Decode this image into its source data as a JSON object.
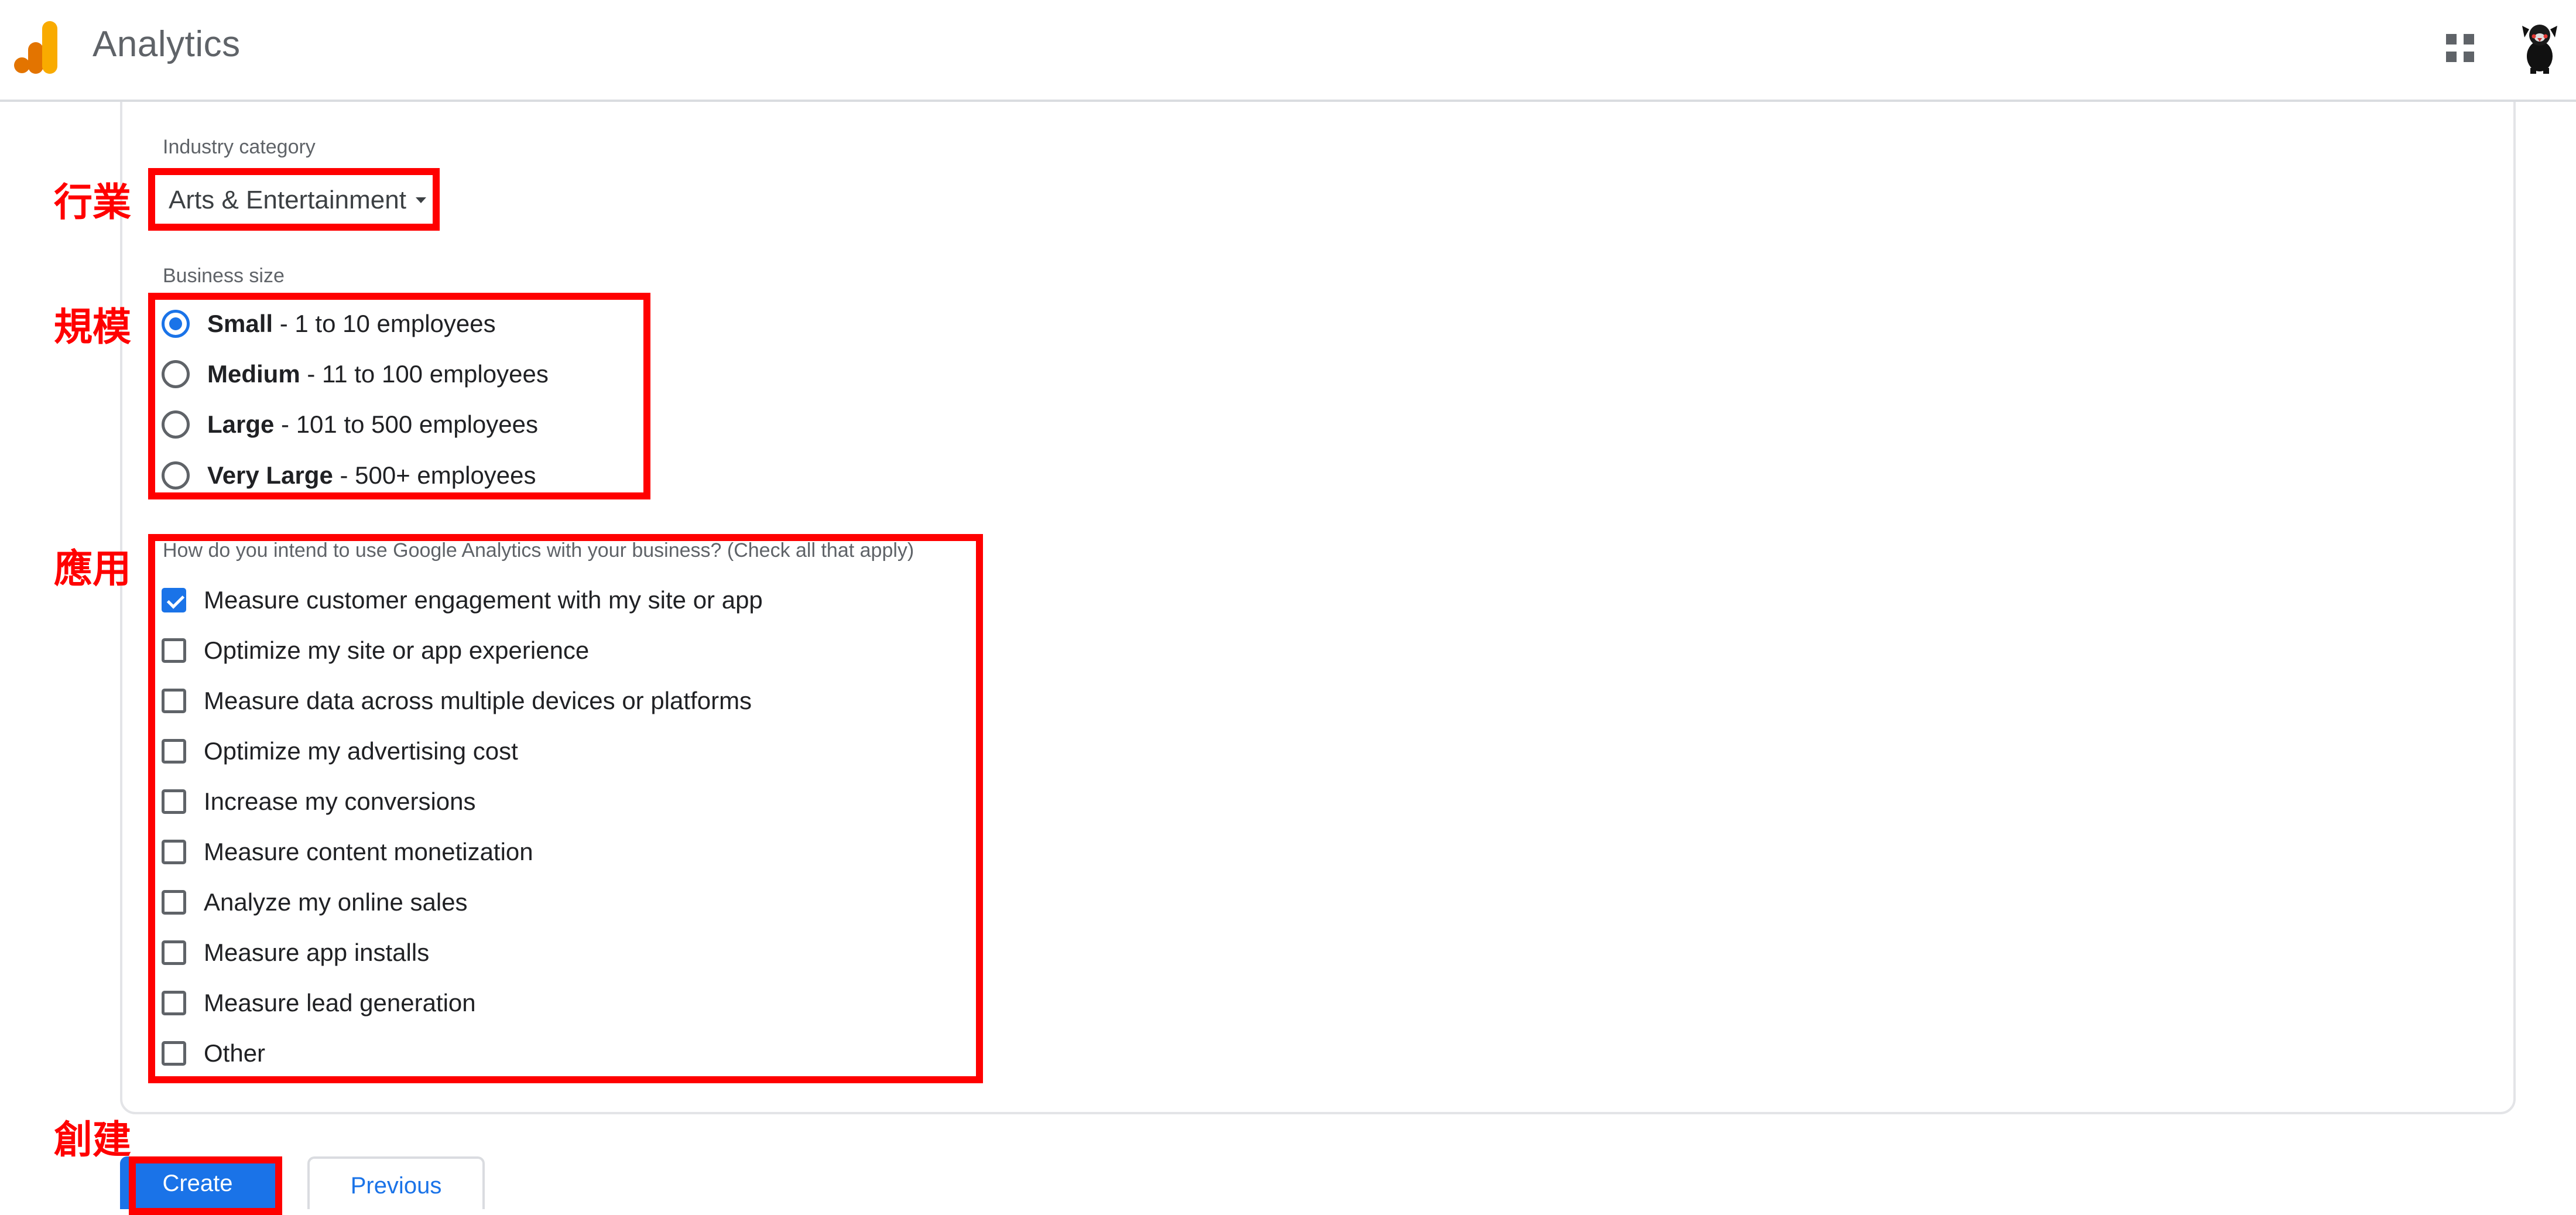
{
  "header": {
    "app_title": "Analytics",
    "icons": {
      "logo": "analytics-logo",
      "apps": "apps-grid-icon",
      "avatar": "user-avatar"
    }
  },
  "form": {
    "cutoff_text": "",
    "industry": {
      "label": "Industry category",
      "selected": "Arts & Entertainment"
    },
    "business_size": {
      "label": "Business size",
      "options": [
        {
          "name": "Small",
          "detail": " - 1 to 10 employees",
          "checked": true
        },
        {
          "name": "Medium",
          "detail": " - 11 to 100 employees",
          "checked": false
        },
        {
          "name": "Large",
          "detail": " - 101 to 500 employees",
          "checked": false
        },
        {
          "name": "Very Large",
          "detail": " - 500+ employees",
          "checked": false
        }
      ]
    },
    "usage": {
      "question": "How do you intend to use Google Analytics with your business? (Check all that apply)",
      "options": [
        {
          "label": "Measure customer engagement with my site or app",
          "checked": true
        },
        {
          "label": "Optimize my site or app experience",
          "checked": false
        },
        {
          "label": "Measure data across multiple devices or platforms",
          "checked": false
        },
        {
          "label": "Optimize my advertising cost",
          "checked": false
        },
        {
          "label": "Increase my conversions",
          "checked": false
        },
        {
          "label": "Measure content monetization",
          "checked": false
        },
        {
          "label": "Analyze my online sales",
          "checked": false
        },
        {
          "label": "Measure app installs",
          "checked": false
        },
        {
          "label": "Measure lead generation",
          "checked": false
        },
        {
          "label": "Other",
          "checked": false
        }
      ]
    },
    "buttons": {
      "create": "Create",
      "previous": "Previous"
    }
  },
  "annotations": {
    "industry": "行業",
    "size": "規模",
    "usage": "應用",
    "create": "創建",
    "color": "#ff0000"
  },
  "colors": {
    "accent": "#1a73e8",
    "logo_dark": "#e37400",
    "logo_light": "#f9ab00",
    "text_secondary": "#5f6368"
  }
}
